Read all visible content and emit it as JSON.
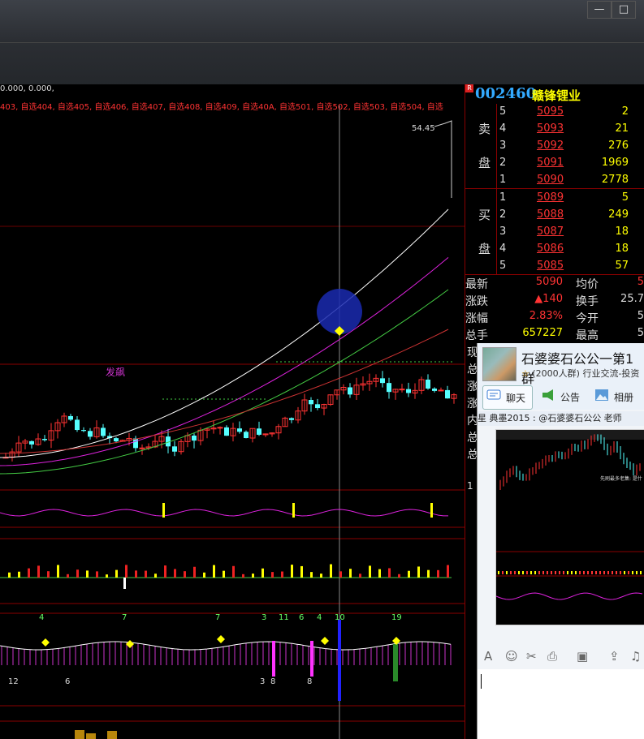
{
  "window": {
    "minimize_icon": "—",
    "maximize_icon": "□"
  },
  "chart": {
    "top_values": "0.000, 0.000,",
    "selections": "403, 自选404, 自选405, 自选406, 自选407, 自选408, 自选409, 自选40A, 自选501, 自选502, 自选503, 自选504, 自选",
    "annotation_price": "54.45",
    "annotation_label": "发飙",
    "panel3_numbers": [
      "4",
      "7",
      "7",
      "3",
      "11",
      "6",
      "4",
      "10",
      "19"
    ],
    "panel3_bottom": [
      "12",
      "6",
      "3",
      "8",
      "8"
    ]
  },
  "quote": {
    "badge": "R",
    "code": "002460",
    "name": "赣锋锂业",
    "sell_label": "卖盘",
    "buy_label": "买盘",
    "sell": [
      {
        "level": "5",
        "price": "5095",
        "volume": "2"
      },
      {
        "level": "4",
        "price": "5093",
        "volume": "21"
      },
      {
        "level": "3",
        "price": "5092",
        "volume": "276"
      },
      {
        "level": "2",
        "price": "5091",
        "volume": "1969"
      },
      {
        "level": "1",
        "price": "5090",
        "volume": "2778"
      }
    ],
    "buy": [
      {
        "level": "1",
        "price": "5089",
        "volume": "5"
      },
      {
        "level": "2",
        "price": "5088",
        "volume": "249"
      },
      {
        "level": "3",
        "price": "5087",
        "volume": "18"
      },
      {
        "level": "4",
        "price": "5086",
        "volume": "18"
      },
      {
        "level": "5",
        "price": "5085",
        "volume": "57"
      }
    ],
    "stats": [
      {
        "label": "最新",
        "value": "5090",
        "label2": "均价",
        "value2": "5"
      },
      {
        "label": "涨跌",
        "value": "▲140",
        "label2": "换手",
        "value2": "25.7"
      },
      {
        "label": "涨幅",
        "value": "2.83%",
        "label2": "今开",
        "value2": "5"
      },
      {
        "label": "总手",
        "value": "657227",
        "label2": "最高",
        "value2": "5"
      }
    ],
    "hidden_labels": [
      "现",
      "总",
      "涨",
      "涨",
      "内",
      "总",
      "总"
    ],
    "side_number": "1"
  },
  "qq": {
    "title": "石婆婆石公公一第1群",
    "subtitle": "(2000人群) 行业交流-投资",
    "tabs": [
      {
        "icon": "chat-icon",
        "label": "聊天"
      },
      {
        "icon": "announcement-icon",
        "label": "公告"
      },
      {
        "icon": "album-icon",
        "label": "相册"
      }
    ],
    "message": "星  典墨2015 : @石婆婆石公公 老师",
    "image_caption": "先刷最多老集: 是什",
    "tools": [
      "A",
      "☺",
      "✂",
      "⎙",
      "▣",
      "⇪",
      "♫"
    ]
  },
  "colors": {
    "up": "#ff3333",
    "down": "#55ffff",
    "accent": "#33aaff"
  }
}
